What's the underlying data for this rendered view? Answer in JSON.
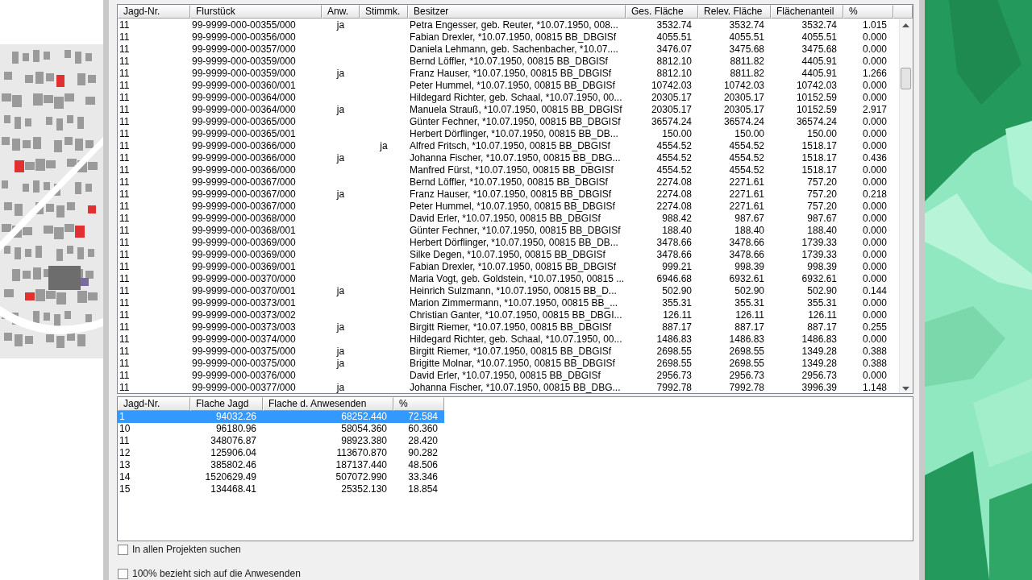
{
  "owners_table": {
    "columns": [
      "Jagd-Nr.",
      "Flurstück",
      "Anw.",
      "Stimmk.",
      "Besitzer",
      "Ges. Fläche",
      "Relev. Fläche",
      "Flächenanteil",
      "%"
    ],
    "rows": [
      {
        "jagd": "11",
        "flurstueck": "99-9999-000-00355/000",
        "anw": "ja",
        "besitzer": "Petra Engesser, geb. Reuter, *10.07.1950, 008...",
        "ges": "3532.74",
        "relev": "3532.74",
        "anteil": "3532.74",
        "pct": "1.015"
      },
      {
        "jagd": "11",
        "flurstueck": "99-9999-000-00356/000",
        "besitzer": "Fabian Drexler, *10.07.1950, 00815 BB_DBGISf",
        "ges": "4055.51",
        "relev": "4055.51",
        "anteil": "4055.51",
        "pct": "0.000"
      },
      {
        "jagd": "11",
        "flurstueck": "99-9999-000-00357/000",
        "besitzer": "Daniela Lehmann, geb. Sachenbacher, *10.07....",
        "ges": "3476.07",
        "relev": "3475.68",
        "anteil": "3475.68",
        "pct": "0.000"
      },
      {
        "jagd": "11",
        "flurstueck": "99-9999-000-00359/000",
        "besitzer": "Bernd Löffler, *10.07.1950, 00815 BB_DBGISf",
        "ges": "8812.10",
        "relev": "8811.82",
        "anteil": "4405.91",
        "pct": "0.000"
      },
      {
        "jagd": "11",
        "flurstueck": "99-9999-000-00359/000",
        "anw": "ja",
        "besitzer": "Franz Hauser, *10.07.1950, 00815 BB_DBGISf",
        "ges": "8812.10",
        "relev": "8811.82",
        "anteil": "4405.91",
        "pct": "1.266"
      },
      {
        "jagd": "11",
        "flurstueck": "99-9999-000-00360/001",
        "besitzer": "Peter Hummel, *10.07.1950, 00815 BB_DBGISf",
        "ges": "10742.03",
        "relev": "10742.03",
        "anteil": "10742.03",
        "pct": "0.000"
      },
      {
        "jagd": "11",
        "flurstueck": "99-9999-000-00364/000",
        "besitzer": "Hildegard Richter, geb. Schaal, *10.07.1950, 00...",
        "ges": "20305.17",
        "relev": "20305.17",
        "anteil": "10152.59",
        "pct": "0.000"
      },
      {
        "jagd": "11",
        "flurstueck": "99-9999-000-00364/000",
        "anw": "ja",
        "besitzer": "Manuela Strauß, *10.07.1950, 00815 BB_DBGISf",
        "ges": "20305.17",
        "relev": "20305.17",
        "anteil": "10152.59",
        "pct": "2.917"
      },
      {
        "jagd": "11",
        "flurstueck": "99-9999-000-00365/000",
        "besitzer": "Günter Fechner, *10.07.1950, 00815 BB_DBGISf",
        "ges": "36574.24",
        "relev": "36574.24",
        "anteil": "36574.24",
        "pct": "0.000"
      },
      {
        "jagd": "11",
        "flurstueck": "99-9999-000-00365/001",
        "besitzer": "Herbert Dörflinger, *10.07.1950, 00815 BB_DB...",
        "ges": "150.00",
        "relev": "150.00",
        "anteil": "150.00",
        "pct": "0.000"
      },
      {
        "jagd": "11",
        "flurstueck": "99-9999-000-00366/000",
        "stimmk": "ja",
        "besitzer": "Alfred Fritsch, *10.07.1950, 00815 BB_DBGISf",
        "ges": "4554.52",
        "relev": "4554.52",
        "anteil": "1518.17",
        "pct": "0.000"
      },
      {
        "jagd": "11",
        "flurstueck": "99-9999-000-00366/000",
        "anw": "ja",
        "besitzer": "Johanna Fischer, *10.07.1950, 00815 BB_DBG...",
        "ges": "4554.52",
        "relev": "4554.52",
        "anteil": "1518.17",
        "pct": "0.436"
      },
      {
        "jagd": "11",
        "flurstueck": "99-9999-000-00366/000",
        "besitzer": "Manfred Fürst, *10.07.1950, 00815 BB_DBGISf",
        "ges": "4554.52",
        "relev": "4554.52",
        "anteil": "1518.17",
        "pct": "0.000"
      },
      {
        "jagd": "11",
        "flurstueck": "99-9999-000-00367/000",
        "besitzer": "Bernd Löffler, *10.07.1950, 00815 BB_DBGISf",
        "ges": "2274.08",
        "relev": "2271.61",
        "anteil": "757.20",
        "pct": "0.000"
      },
      {
        "jagd": "11",
        "flurstueck": "99-9999-000-00367/000",
        "anw": "ja",
        "besitzer": "Franz Hauser, *10.07.1950, 00815 BB_DBGISf",
        "ges": "2274.08",
        "relev": "2271.61",
        "anteil": "757.20",
        "pct": "0.218"
      },
      {
        "jagd": "11",
        "flurstueck": "99-9999-000-00367/000",
        "besitzer": "Peter Hummel, *10.07.1950, 00815 BB_DBGISf",
        "ges": "2274.08",
        "relev": "2271.61",
        "anteil": "757.20",
        "pct": "0.000"
      },
      {
        "jagd": "11",
        "flurstueck": "99-9999-000-00368/000",
        "besitzer": "David Erler, *10.07.1950, 00815 BB_DBGISf",
        "ges": "988.42",
        "relev": "987.67",
        "anteil": "987.67",
        "pct": "0.000"
      },
      {
        "jagd": "11",
        "flurstueck": "99-9999-000-00368/001",
        "besitzer": "Günter Fechner, *10.07.1950, 00815 BB_DBGISf",
        "ges": "188.40",
        "relev": "188.40",
        "anteil": "188.40",
        "pct": "0.000"
      },
      {
        "jagd": "11",
        "flurstueck": "99-9999-000-00369/000",
        "besitzer": "Herbert Dörflinger, *10.07.1950, 00815 BB_DB...",
        "ges": "3478.66",
        "relev": "3478.66",
        "anteil": "1739.33",
        "pct": "0.000"
      },
      {
        "jagd": "11",
        "flurstueck": "99-9999-000-00369/000",
        "besitzer": "Silke Degen, *10.07.1950, 00815 BB_DBGISf",
        "ges": "3478.66",
        "relev": "3478.66",
        "anteil": "1739.33",
        "pct": "0.000"
      },
      {
        "jagd": "11",
        "flurstueck": "99-9999-000-00369/001",
        "besitzer": "Fabian Drexler, *10.07.1950, 00815 BB_DBGISf",
        "ges": "999.21",
        "relev": "998.39",
        "anteil": "998.39",
        "pct": "0.000"
      },
      {
        "jagd": "11",
        "flurstueck": "99-9999-000-00370/000",
        "besitzer": "Maria Vogt, geb. Goldstein, *10.07.1950, 00815 ...",
        "ges": "6946.68",
        "relev": "6932.61",
        "anteil": "6932.61",
        "pct": "0.000"
      },
      {
        "jagd": "11",
        "flurstueck": "99-9999-000-00370/001",
        "anw": "ja",
        "besitzer": "Heinrich Sulzmann, *10.07.1950, 00815 BB_D...",
        "ges": "502.90",
        "relev": "502.90",
        "anteil": "502.90",
        "pct": "0.144"
      },
      {
        "jagd": "11",
        "flurstueck": "99-9999-000-00373/001",
        "besitzer": "Marion Zimmermann, *10.07.1950, 00815 BB_...",
        "ges": "355.31",
        "relev": "355.31",
        "anteil": "355.31",
        "pct": "0.000"
      },
      {
        "jagd": "11",
        "flurstueck": "99-9999-000-00373/002",
        "besitzer": "Christian Ganter, *10.07.1950, 00815 BB_DBGI...",
        "ges": "126.11",
        "relev": "126.11",
        "anteil": "126.11",
        "pct": "0.000"
      },
      {
        "jagd": "11",
        "flurstueck": "99-9999-000-00373/003",
        "anw": "ja",
        "besitzer": "Birgitt Riemer, *10.07.1950, 00815 BB_DBGISf",
        "ges": "887.17",
        "relev": "887.17",
        "anteil": "887.17",
        "pct": "0.255"
      },
      {
        "jagd": "11",
        "flurstueck": "99-9999-000-00374/000",
        "besitzer": "Hildegard Richter, geb. Schaal, *10.07.1950, 00...",
        "ges": "1486.83",
        "relev": "1486.83",
        "anteil": "1486.83",
        "pct": "0.000"
      },
      {
        "jagd": "11",
        "flurstueck": "99-9999-000-00375/000",
        "anw": "ja",
        "besitzer": "Birgitt Riemer, *10.07.1950, 00815 BB_DBGISf",
        "ges": "2698.55",
        "relev": "2698.55",
        "anteil": "1349.28",
        "pct": "0.388"
      },
      {
        "jagd": "11",
        "flurstueck": "99-9999-000-00375/000",
        "anw": "ja",
        "besitzer": "Brigitte Molnar, *10.07.1950, 00815 BB_DBGISf",
        "ges": "2698.55",
        "relev": "2698.55",
        "anteil": "1349.28",
        "pct": "0.388"
      },
      {
        "jagd": "11",
        "flurstueck": "99-9999-000-00376/000",
        "besitzer": "David Erler, *10.07.1950, 00815 BB_DBGISf",
        "ges": "2956.73",
        "relev": "2956.73",
        "anteil": "2956.73",
        "pct": "0.000"
      },
      {
        "jagd": "11",
        "flurstueck": "99-9999-000-00377/000",
        "anw": "ja",
        "besitzer": "Johanna Fischer, *10.07.1950, 00815 BB_DBG...",
        "ges": "7992.78",
        "relev": "7992.78",
        "anteil": "3996.39",
        "pct": "1.148"
      }
    ]
  },
  "summary_table": {
    "columns": [
      "Jagd-Nr.",
      "Flache Jagd",
      "Flache d. Anwesenden",
      "%"
    ],
    "rows": [
      {
        "jagd": "1",
        "flaeche": "94032.26",
        "anwesend": "68252.440",
        "pct": "72.584",
        "selected": true
      },
      {
        "jagd": "10",
        "flaeche": "96180.96",
        "anwesend": "58054.360",
        "pct": "60.360",
        "selected": false
      },
      {
        "jagd": "11",
        "flaeche": "348076.87",
        "anwesend": "98923.380",
        "pct": "28.420",
        "selected": false
      },
      {
        "jagd": "12",
        "flaeche": "125906.04",
        "anwesend": "113670.870",
        "pct": "90.282",
        "selected": false
      },
      {
        "jagd": "13",
        "flaeche": "385802.46",
        "anwesend": "187137.440",
        "pct": "48.506",
        "selected": false
      },
      {
        "jagd": "14",
        "flaeche": "1520629.49",
        "anwesend": "507072.990",
        "pct": "33.346",
        "selected": false
      },
      {
        "jagd": "15",
        "flaeche": "134468.41",
        "anwesend": "25352.130",
        "pct": "18.854",
        "selected": false
      }
    ]
  },
  "options": [
    {
      "label": "In allen Projekten suchen",
      "checked": false
    },
    {
      "label": "100% bezieht sich auf die Anwesenden",
      "checked": false
    }
  ]
}
